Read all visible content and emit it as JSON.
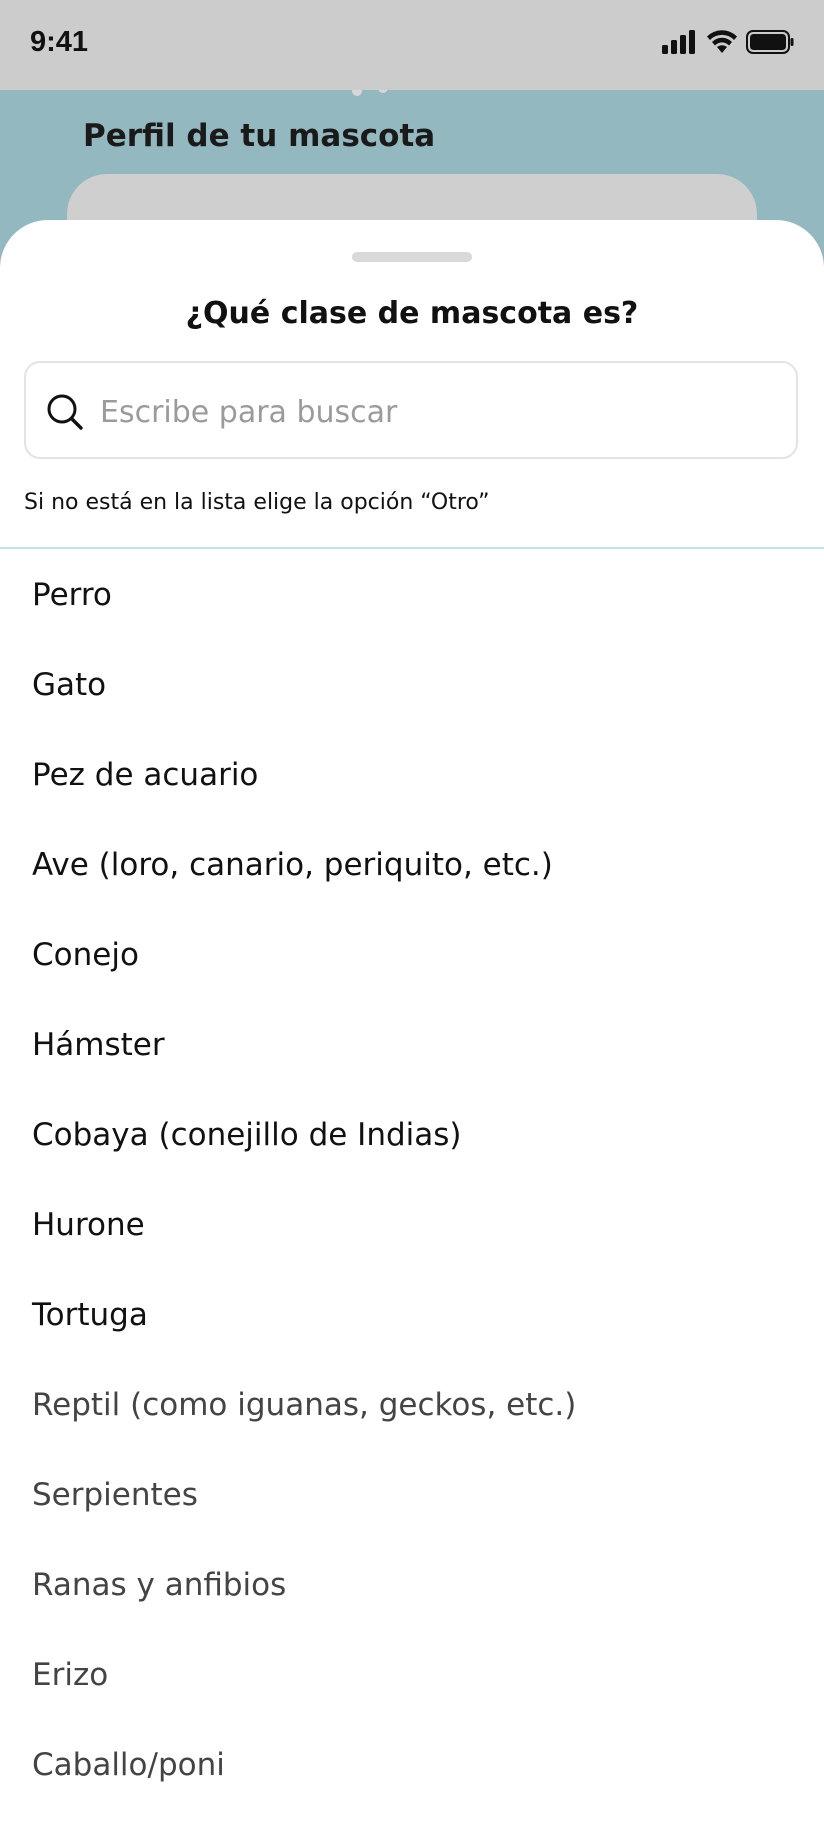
{
  "status_bar": {
    "time": "9:41"
  },
  "background": {
    "title": "Perfil de tu mascota"
  },
  "sheet": {
    "title": "¿Qué clase de mascota es?",
    "search": {
      "placeholder": "Escribe para buscar",
      "value": ""
    },
    "hint": "Si no está en la lista elige la opción “Otro”",
    "items": [
      {
        "label": "Perro"
      },
      {
        "label": "Gato"
      },
      {
        "label": "Pez de acuario"
      },
      {
        "label": "Ave (loro, canario, periquito, etc.)"
      },
      {
        "label": "Conejo"
      },
      {
        "label": "Hámster"
      },
      {
        "label": "Cobaya (conejillo de Indias)"
      },
      {
        "label": "Hurone"
      },
      {
        "label": "Tortuga"
      },
      {
        "label": "Reptil (como iguanas, geckos, etc.)"
      },
      {
        "label": "Serpientes"
      },
      {
        "label": "Ranas y anfibios"
      },
      {
        "label": "Erizo"
      },
      {
        "label": "Caballo/poni"
      }
    ]
  },
  "colors": {
    "status_bar_bg": "#cccccc",
    "header_bg": "#93b8bf",
    "divider": "#bfe3ee",
    "placeholder": "#9b9b9b"
  },
  "icons": {
    "signal": "signal-icon",
    "wifi": "wifi-icon",
    "battery": "battery-icon",
    "search": "search-icon"
  }
}
